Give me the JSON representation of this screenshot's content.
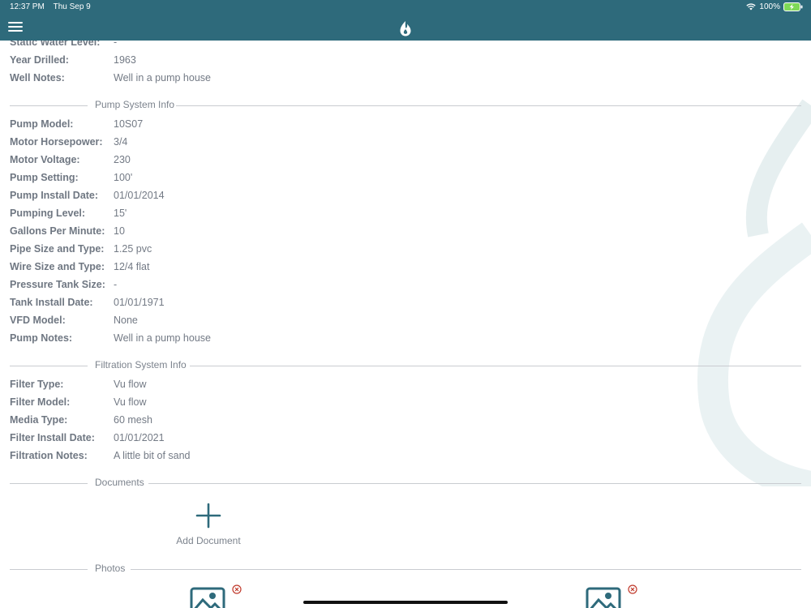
{
  "status_bar": {
    "time": "12:37 PM",
    "date": "Thu Sep 9",
    "battery": "100%"
  },
  "well_rows": [
    {
      "label": "Static Water Level:",
      "value": "-"
    },
    {
      "label": "Year Drilled:",
      "value": "1963"
    },
    {
      "label": "Well Notes:",
      "value": "Well in a pump house"
    }
  ],
  "pump_section": {
    "title": "Pump System Info",
    "rows": [
      {
        "label": "Pump Model:",
        "value": "10S07"
      },
      {
        "label": "Motor Horsepower:",
        "value": "3/4"
      },
      {
        "label": "Motor Voltage:",
        "value": "230"
      },
      {
        "label": "Pump Setting:",
        "value": "100'"
      },
      {
        "label": "Pump Install Date:",
        "value": "01/01/2014"
      },
      {
        "label": "Pumping Level:",
        "value": "15'"
      },
      {
        "label": "Gallons Per Minute:",
        "value": "10"
      },
      {
        "label": "Pipe Size and Type:",
        "value": "1.25 pvc"
      },
      {
        "label": "Wire Size and Type:",
        "value": "12/4 flat"
      },
      {
        "label": "Pressure Tank Size:",
        "value": "-"
      },
      {
        "label": "Tank Install Date:",
        "value": "01/01/1971"
      },
      {
        "label": "VFD Model:",
        "value": "None"
      },
      {
        "label": "Pump Notes:",
        "value": "Well in a pump house"
      }
    ]
  },
  "filtration_section": {
    "title": "Filtration System Info",
    "rows": [
      {
        "label": "Filter Type:",
        "value": "Vu flow"
      },
      {
        "label": "Filter Model:",
        "value": "Vu flow"
      },
      {
        "label": "Media Type:",
        "value": "60 mesh"
      },
      {
        "label": "Filter Install Date:",
        "value": "01/01/2021"
      },
      {
        "label": "Filtration Notes:",
        "value": "A little bit of sand"
      }
    ]
  },
  "documents_section": {
    "title": "Documents",
    "add_label": "Add Document"
  },
  "photos_section": {
    "title": "Photos"
  },
  "colors": {
    "header": "#2e6a7b",
    "accent": "#2e6a7b",
    "remove": "#c0392b"
  }
}
